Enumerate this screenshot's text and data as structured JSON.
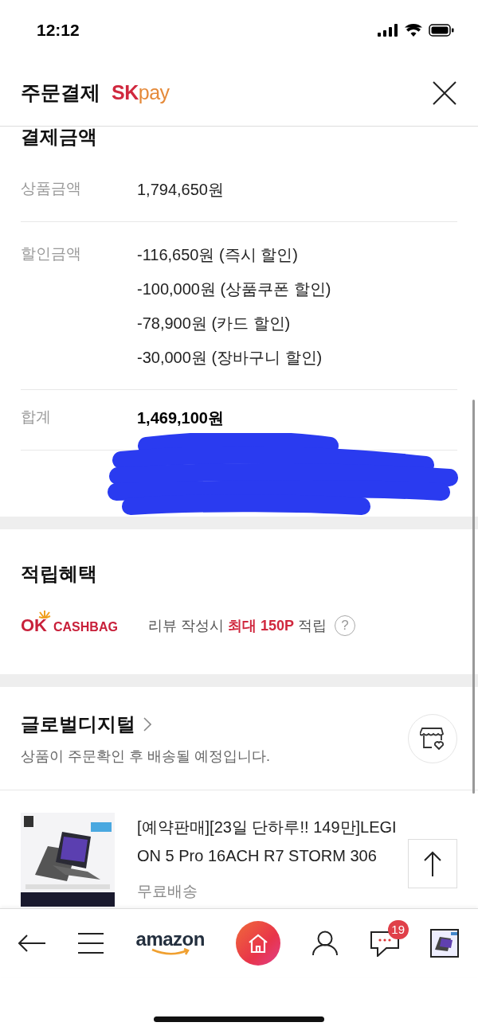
{
  "status_bar": {
    "time": "12:12"
  },
  "header": {
    "title": "주문결제",
    "brand": {
      "first": "SK",
      "second": "pay"
    }
  },
  "payment": {
    "section_title": "결제금액",
    "rows": [
      {
        "kind": "item",
        "label": "상품금액",
        "values": [
          "1,794,650원"
        ]
      },
      {
        "kind": "item",
        "label": "할인금액",
        "values": [
          "-116,650원 (즉시 할인)",
          "-100,000원 (상품쿠폰 할인)",
          "-78,900원 (카드 할인)",
          "-30,000원 (장바구니 할인)"
        ]
      },
      {
        "kind": "total",
        "label": "합계",
        "values": [
          "1,469,100원"
        ]
      }
    ]
  },
  "points": {
    "title": "적립혜택",
    "brand": {
      "first": "OK",
      "second": "CASHBAG"
    },
    "text": "리뷰 작성시 **최대 150P** 적립",
    "help": "?"
  },
  "seller": {
    "name": "글로벌디지털",
    "note": "상품이 주문확인 후 배송될 예정입니다."
  },
  "product": {
    "title": "[예약판매][23일 단하루!! 149만]LEGION 5 Pro 16ACH R7 STORM 306",
    "shipping": "무료배송"
  },
  "nav": {
    "logo": "amazon",
    "chat_badge": "19"
  }
}
